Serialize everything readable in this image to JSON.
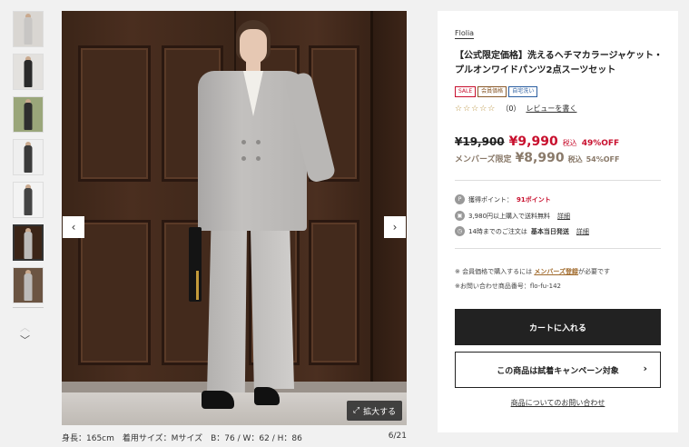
{
  "thumbnails": [
    {
      "name": "thumb-1",
      "color": "#c8c6c4",
      "bg": "#d9d6d2"
    },
    {
      "name": "thumb-2",
      "color": "#2a2a2a",
      "bg": "#e3e1de"
    },
    {
      "name": "thumb-3",
      "color": "#2e2e2e",
      "bg": "#9aa67a"
    },
    {
      "name": "thumb-4",
      "color": "#3b3b3b",
      "bg": "#efefef"
    },
    {
      "name": "thumb-5",
      "color": "#444",
      "bg": "#f3f3f3"
    },
    {
      "name": "thumb-6",
      "color": "#bdbbb9",
      "bg": "#3b2518"
    },
    {
      "name": "thumb-7",
      "color": "#bdbbb9",
      "bg": "#6b5442"
    }
  ],
  "gallery": {
    "zoom_label": "拡大する",
    "caption_model": "身長：165cm　着用サイズ：Mサイズ　B：76 / W：62 / H：86",
    "caption_counter": "6/21",
    "prev_icon": "chevron-left-icon",
    "next_icon": "chevron-right-icon"
  },
  "product": {
    "brand": "Flolia",
    "title": "【公式限定価格】洗えるヘチマカラージャケット・プルオンワイドパンツ2点スーツセット",
    "badges": [
      "SALE",
      "会員価格",
      "自宅洗い"
    ],
    "stars": "☆☆☆☆☆",
    "review_count": "（0）",
    "review_link": "レビューを書く",
    "original_price": "¥19,900",
    "sale_price": "¥9,990",
    "tax_label": "税込",
    "discount": "49%OFF",
    "member_label": "メンバーズ限定",
    "member_price": "¥8,990",
    "member_tax": "税込",
    "member_discount": "54%OFF",
    "points_label": "獲得ポイント：",
    "points_value": "91ポイント",
    "shipping_text": "3,980円以上購入で送料無料",
    "shipping_link": "詳細",
    "dispatch_text_1": "14時までのご注文は",
    "dispatch_text_bold": "基本当日発送",
    "dispatch_link": "詳細",
    "member_note_pre": "※ 会員価格で購入するには",
    "member_note_link": "メンバーズ登録",
    "member_note_post": "が必要です",
    "item_no": "※お問い合わせ商品番号：flo-fu-142",
    "cart_button": "カートに入れる",
    "trial_button": "この商品は試着キャンペーン対象",
    "inquiry_link": "商品についてのお問い合わせ"
  },
  "colors": {
    "accent_red": "#c8102e",
    "member_brown": "#8a7a6a",
    "cart_bg": "#222222"
  }
}
